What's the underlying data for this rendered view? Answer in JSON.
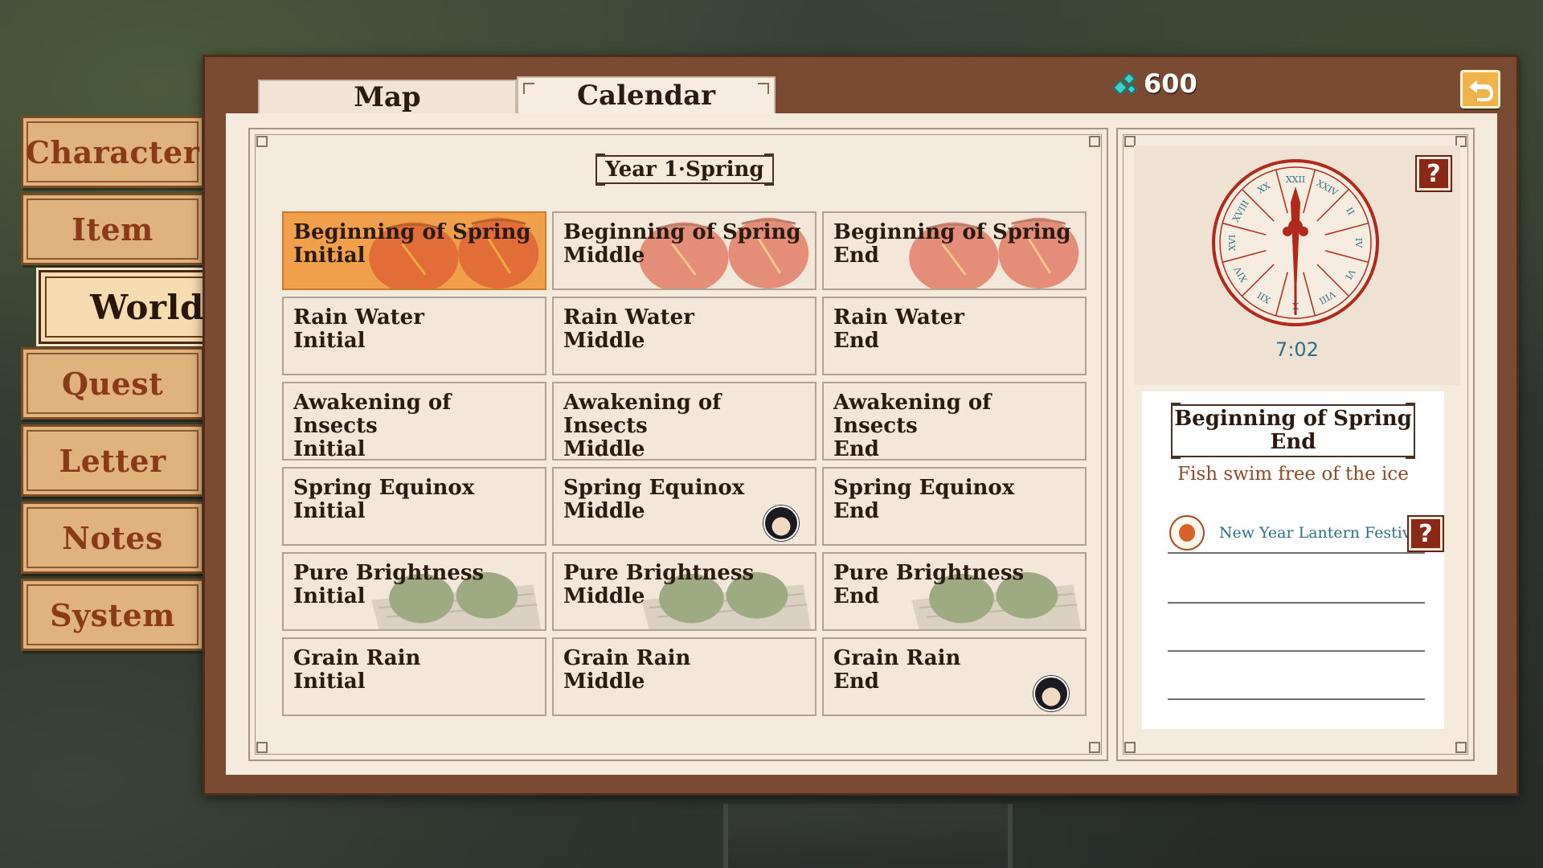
{
  "side_menu": [
    {
      "id": "character",
      "label": "Character",
      "active": false
    },
    {
      "id": "item",
      "label": "Item",
      "active": false
    },
    {
      "id": "world",
      "label": "World",
      "active": true
    },
    {
      "id": "quest",
      "label": "Quest",
      "active": false
    },
    {
      "id": "letter",
      "label": "Letter",
      "active": false
    },
    {
      "id": "notes",
      "label": "Notes",
      "active": false
    },
    {
      "id": "system",
      "label": "System",
      "active": false
    }
  ],
  "tabs": [
    {
      "label": "Map",
      "active": false
    },
    {
      "label": "Calendar",
      "active": true
    }
  ],
  "currency": {
    "icon": "gem-icon",
    "value": "600"
  },
  "back_button": {
    "icon": "back-arrow-icon"
  },
  "calendar": {
    "title": "Year 1·Spring",
    "rows": [
      [
        {
          "term": "Beginning of Spring",
          "phase": "Initial",
          "art": "lantern",
          "state": "selected"
        },
        {
          "term": "Beginning of Spring",
          "phase": "Middle",
          "art": "lantern"
        },
        {
          "term": "Beginning of Spring",
          "phase": "End",
          "art": "lantern",
          "state": "cursor"
        }
      ],
      [
        {
          "term": "Rain Water",
          "phase": "Initial"
        },
        {
          "term": "Rain Water",
          "phase": "Middle"
        },
        {
          "term": "Rain Water",
          "phase": "End"
        }
      ],
      [
        {
          "term": "Awakening of Insects",
          "phase": "Initial"
        },
        {
          "term": "Awakening of Insects",
          "phase": "Middle"
        },
        {
          "term": "Awakening of Insects",
          "phase": "End"
        }
      ],
      [
        {
          "term": "Spring Equinox",
          "phase": "Initial"
        },
        {
          "term": "Spring Equinox",
          "phase": "Middle",
          "marker": "character-portrait"
        },
        {
          "term": "Spring Equinox",
          "phase": "End"
        }
      ],
      [
        {
          "term": "Pure Brightness",
          "phase": "Initial",
          "art": "qingtuan"
        },
        {
          "term": "Pure Brightness",
          "phase": "Middle",
          "art": "qingtuan"
        },
        {
          "term": "Pure Brightness",
          "phase": "End",
          "art": "qingtuan"
        }
      ],
      [
        {
          "term": "Grain Rain",
          "phase": "Initial"
        },
        {
          "term": "Grain Rain",
          "phase": "Middle"
        },
        {
          "term": "Grain Rain",
          "phase": "End",
          "marker": "character-portrait"
        }
      ]
    ]
  },
  "info": {
    "clock_numerals": [
      "XXII",
      "XXIV",
      "II",
      "IV",
      "VI",
      "VIII",
      "X",
      "XII",
      "XIV",
      "XVI",
      "XVIII",
      "XX"
    ],
    "time": "7:02",
    "term_line1": "Beginning of Spring",
    "term_line2": "End",
    "description": "Fish swim free of the ice",
    "events": [
      {
        "icon": "lantern-icon",
        "label": "New Year Lantern Festival"
      }
    ],
    "help_icon": "?"
  },
  "colors": {
    "panel_brown": "#7b4a33",
    "parchment": "#f5ebdc",
    "selected_cell": "#f0a04a",
    "cursor_red": "#e23a2a",
    "menu_tan": "#e0b27e",
    "teal_text": "#2f6f86"
  }
}
